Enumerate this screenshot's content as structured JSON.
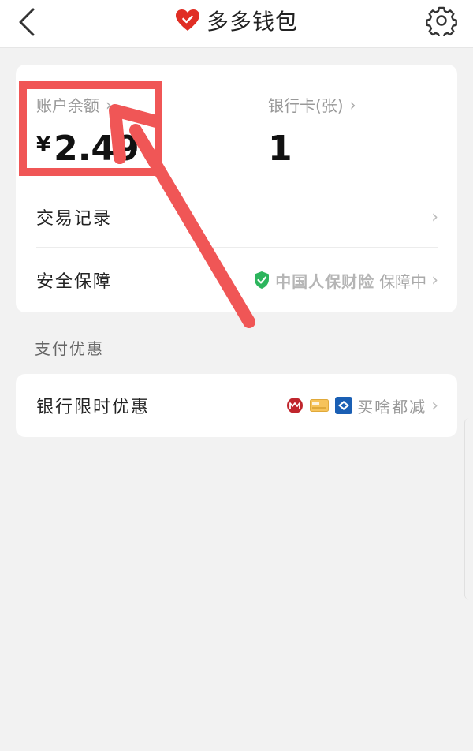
{
  "header": {
    "title": "多多钱包",
    "back_icon": "chevron-left-icon",
    "settings_icon": "gear-icon",
    "brand_color": "#e02e24"
  },
  "wallet": {
    "balance_label": "账户余额",
    "balance_currency": "¥",
    "balance_value": "2.49",
    "cards_label": "银行卡(张)",
    "cards_value": "1"
  },
  "rows": {
    "transactions_label": "交易记录",
    "security_label": "安全保障",
    "insurer": "中国人保财险",
    "insurer_suffix": "保障中"
  },
  "section": {
    "payment_offers_title": "支付优惠"
  },
  "offer_row": {
    "label": "银行限时优惠",
    "promo_text": "买啥都减",
    "bank_icons": [
      "cmb-bank-icon",
      "card-icon",
      "bank-icon"
    ]
  },
  "colors": {
    "annotation_red": "#f05656",
    "shield_green": "#2db55d"
  }
}
